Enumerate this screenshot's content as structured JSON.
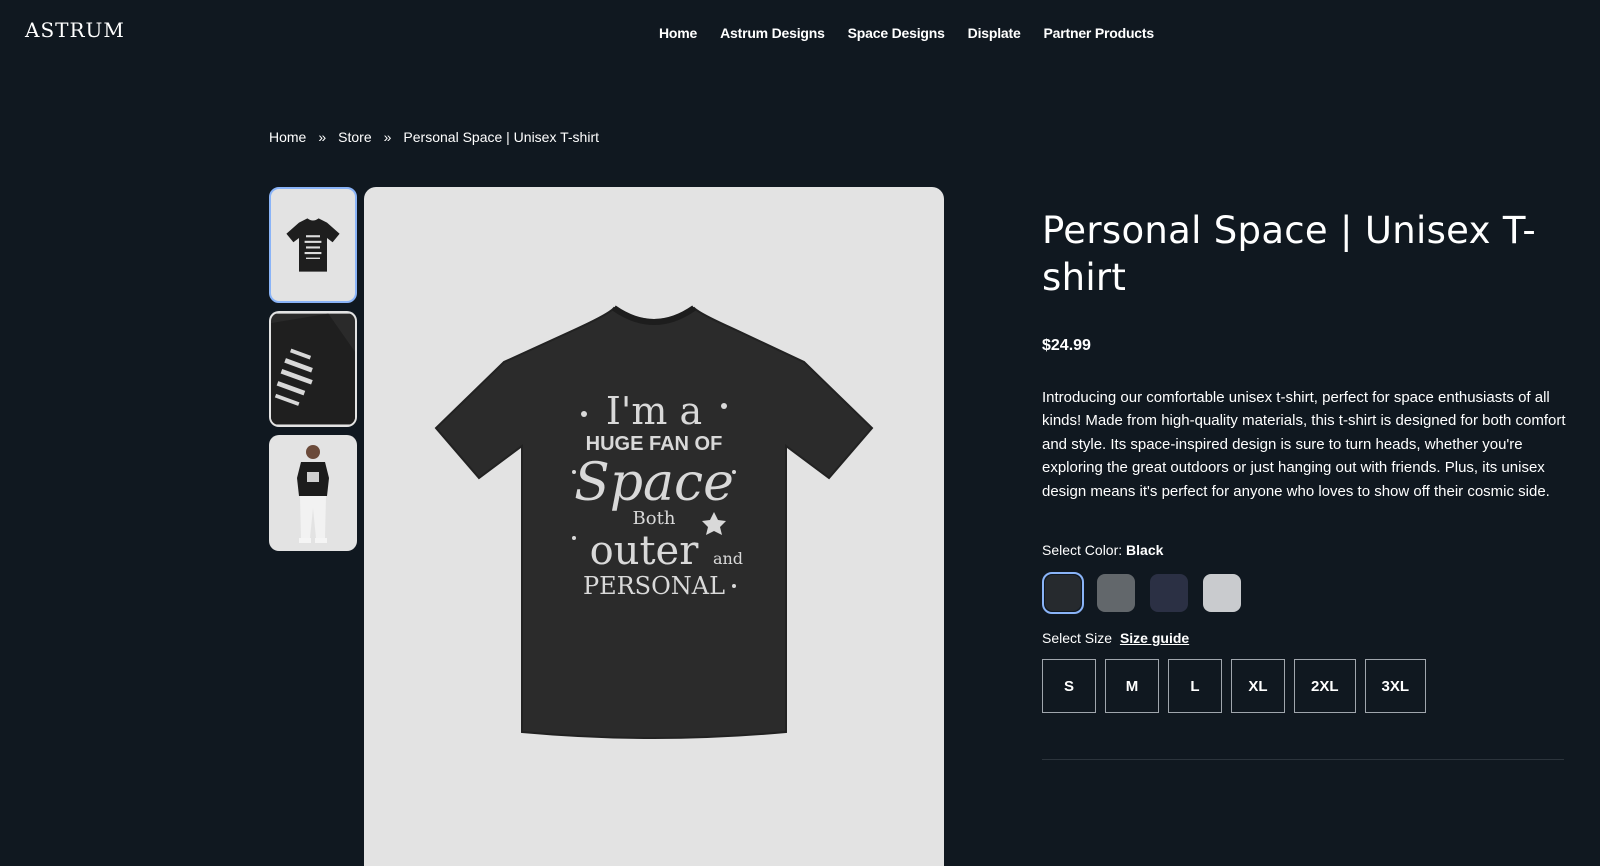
{
  "header": {
    "logo": "ASTRUM",
    "nav": [
      "Home",
      "Astrum Designs",
      "Space Designs",
      "Displate",
      "Partner Products"
    ]
  },
  "breadcrumb": {
    "items": [
      "Home",
      "Store",
      "Personal Space | Unisex T-shirt"
    ],
    "separator": "»"
  },
  "gallery": {
    "thumbnails": [
      "tshirt-front",
      "tshirt-folded",
      "model-wearing-tshirt"
    ],
    "active_index": 0,
    "main_image_text": [
      "I'm a",
      "HUGE FAN OF",
      "Space",
      "Both",
      "outer",
      "and",
      "PERSONAL"
    ]
  },
  "product": {
    "title": "Personal Space | Unisex T-shirt",
    "price": "$24.99",
    "description": "Introducing our comfortable unisex t-shirt, perfect for space enthusiasts of all kinds! Made from high-quality materials, this t-shirt is designed for both comfort and style. Its space-inspired design is sure to turn heads, whether you're exploring the great outdoors or just hanging out with friends. Plus, its unisex design means it's perfect for anyone who loves to show off their cosmic side.",
    "color_label": "Select Color:",
    "color_selected": "Black",
    "colors": [
      {
        "name": "Black",
        "hex": "#262a2e"
      },
      {
        "name": "Dark Grey",
        "hex": "#62676b"
      },
      {
        "name": "Navy",
        "hex": "#2b3044"
      },
      {
        "name": "Light Grey",
        "hex": "#c9cbce"
      }
    ],
    "size_label": "Select Size",
    "size_guide": "Size guide",
    "sizes": [
      "S",
      "M",
      "L",
      "XL",
      "2XL",
      "3XL"
    ]
  },
  "colors": {
    "background": "#101820",
    "accent_border": "#8ab4f8",
    "image_bg": "#e3e3e3"
  }
}
